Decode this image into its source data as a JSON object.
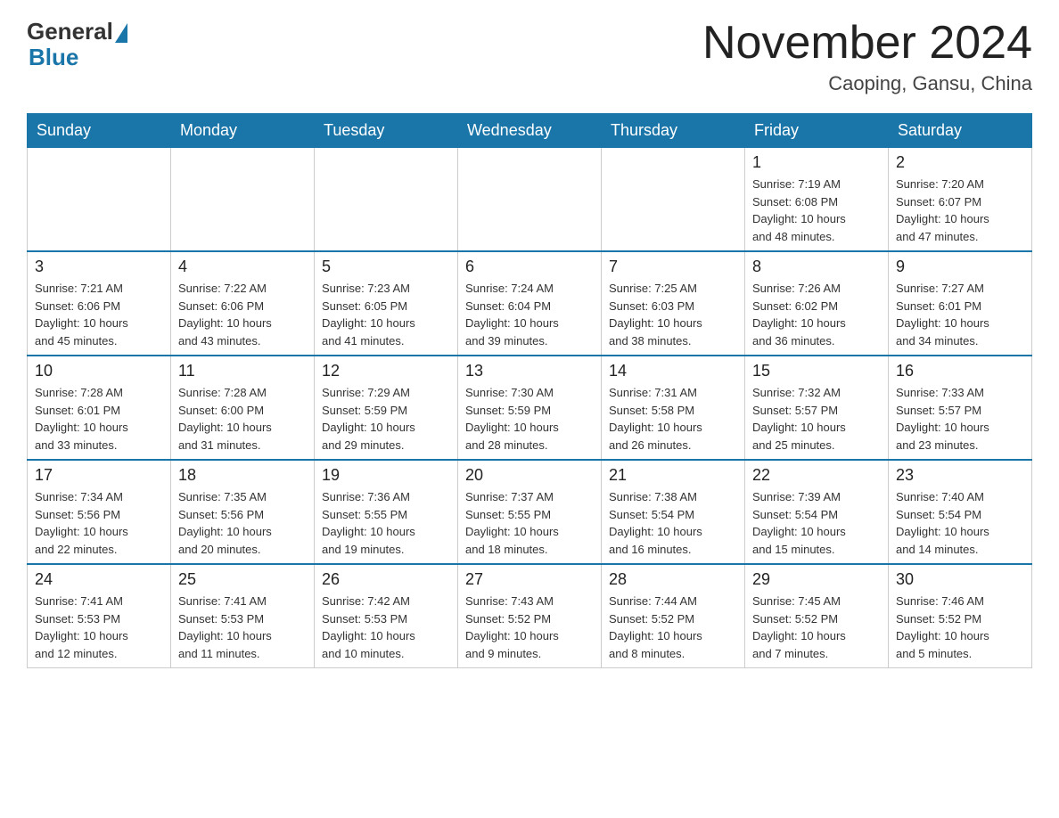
{
  "logo": {
    "general": "General",
    "blue": "Blue"
  },
  "title": "November 2024",
  "subtitle": "Caoping, Gansu, China",
  "weekdays": [
    "Sunday",
    "Monday",
    "Tuesday",
    "Wednesday",
    "Thursday",
    "Friday",
    "Saturday"
  ],
  "weeks": [
    [
      {
        "day": "",
        "info": ""
      },
      {
        "day": "",
        "info": ""
      },
      {
        "day": "",
        "info": ""
      },
      {
        "day": "",
        "info": ""
      },
      {
        "day": "",
        "info": ""
      },
      {
        "day": "1",
        "info": "Sunrise: 7:19 AM\nSunset: 6:08 PM\nDaylight: 10 hours\nand 48 minutes."
      },
      {
        "day": "2",
        "info": "Sunrise: 7:20 AM\nSunset: 6:07 PM\nDaylight: 10 hours\nand 47 minutes."
      }
    ],
    [
      {
        "day": "3",
        "info": "Sunrise: 7:21 AM\nSunset: 6:06 PM\nDaylight: 10 hours\nand 45 minutes."
      },
      {
        "day": "4",
        "info": "Sunrise: 7:22 AM\nSunset: 6:06 PM\nDaylight: 10 hours\nand 43 minutes."
      },
      {
        "day": "5",
        "info": "Sunrise: 7:23 AM\nSunset: 6:05 PM\nDaylight: 10 hours\nand 41 minutes."
      },
      {
        "day": "6",
        "info": "Sunrise: 7:24 AM\nSunset: 6:04 PM\nDaylight: 10 hours\nand 39 minutes."
      },
      {
        "day": "7",
        "info": "Sunrise: 7:25 AM\nSunset: 6:03 PM\nDaylight: 10 hours\nand 38 minutes."
      },
      {
        "day": "8",
        "info": "Sunrise: 7:26 AM\nSunset: 6:02 PM\nDaylight: 10 hours\nand 36 minutes."
      },
      {
        "day": "9",
        "info": "Sunrise: 7:27 AM\nSunset: 6:01 PM\nDaylight: 10 hours\nand 34 minutes."
      }
    ],
    [
      {
        "day": "10",
        "info": "Sunrise: 7:28 AM\nSunset: 6:01 PM\nDaylight: 10 hours\nand 33 minutes."
      },
      {
        "day": "11",
        "info": "Sunrise: 7:28 AM\nSunset: 6:00 PM\nDaylight: 10 hours\nand 31 minutes."
      },
      {
        "day": "12",
        "info": "Sunrise: 7:29 AM\nSunset: 5:59 PM\nDaylight: 10 hours\nand 29 minutes."
      },
      {
        "day": "13",
        "info": "Sunrise: 7:30 AM\nSunset: 5:59 PM\nDaylight: 10 hours\nand 28 minutes."
      },
      {
        "day": "14",
        "info": "Sunrise: 7:31 AM\nSunset: 5:58 PM\nDaylight: 10 hours\nand 26 minutes."
      },
      {
        "day": "15",
        "info": "Sunrise: 7:32 AM\nSunset: 5:57 PM\nDaylight: 10 hours\nand 25 minutes."
      },
      {
        "day": "16",
        "info": "Sunrise: 7:33 AM\nSunset: 5:57 PM\nDaylight: 10 hours\nand 23 minutes."
      }
    ],
    [
      {
        "day": "17",
        "info": "Sunrise: 7:34 AM\nSunset: 5:56 PM\nDaylight: 10 hours\nand 22 minutes."
      },
      {
        "day": "18",
        "info": "Sunrise: 7:35 AM\nSunset: 5:56 PM\nDaylight: 10 hours\nand 20 minutes."
      },
      {
        "day": "19",
        "info": "Sunrise: 7:36 AM\nSunset: 5:55 PM\nDaylight: 10 hours\nand 19 minutes."
      },
      {
        "day": "20",
        "info": "Sunrise: 7:37 AM\nSunset: 5:55 PM\nDaylight: 10 hours\nand 18 minutes."
      },
      {
        "day": "21",
        "info": "Sunrise: 7:38 AM\nSunset: 5:54 PM\nDaylight: 10 hours\nand 16 minutes."
      },
      {
        "day": "22",
        "info": "Sunrise: 7:39 AM\nSunset: 5:54 PM\nDaylight: 10 hours\nand 15 minutes."
      },
      {
        "day": "23",
        "info": "Sunrise: 7:40 AM\nSunset: 5:54 PM\nDaylight: 10 hours\nand 14 minutes."
      }
    ],
    [
      {
        "day": "24",
        "info": "Sunrise: 7:41 AM\nSunset: 5:53 PM\nDaylight: 10 hours\nand 12 minutes."
      },
      {
        "day": "25",
        "info": "Sunrise: 7:41 AM\nSunset: 5:53 PM\nDaylight: 10 hours\nand 11 minutes."
      },
      {
        "day": "26",
        "info": "Sunrise: 7:42 AM\nSunset: 5:53 PM\nDaylight: 10 hours\nand 10 minutes."
      },
      {
        "day": "27",
        "info": "Sunrise: 7:43 AM\nSunset: 5:52 PM\nDaylight: 10 hours\nand 9 minutes."
      },
      {
        "day": "28",
        "info": "Sunrise: 7:44 AM\nSunset: 5:52 PM\nDaylight: 10 hours\nand 8 minutes."
      },
      {
        "day": "29",
        "info": "Sunrise: 7:45 AM\nSunset: 5:52 PM\nDaylight: 10 hours\nand 7 minutes."
      },
      {
        "day": "30",
        "info": "Sunrise: 7:46 AM\nSunset: 5:52 PM\nDaylight: 10 hours\nand 5 minutes."
      }
    ]
  ]
}
